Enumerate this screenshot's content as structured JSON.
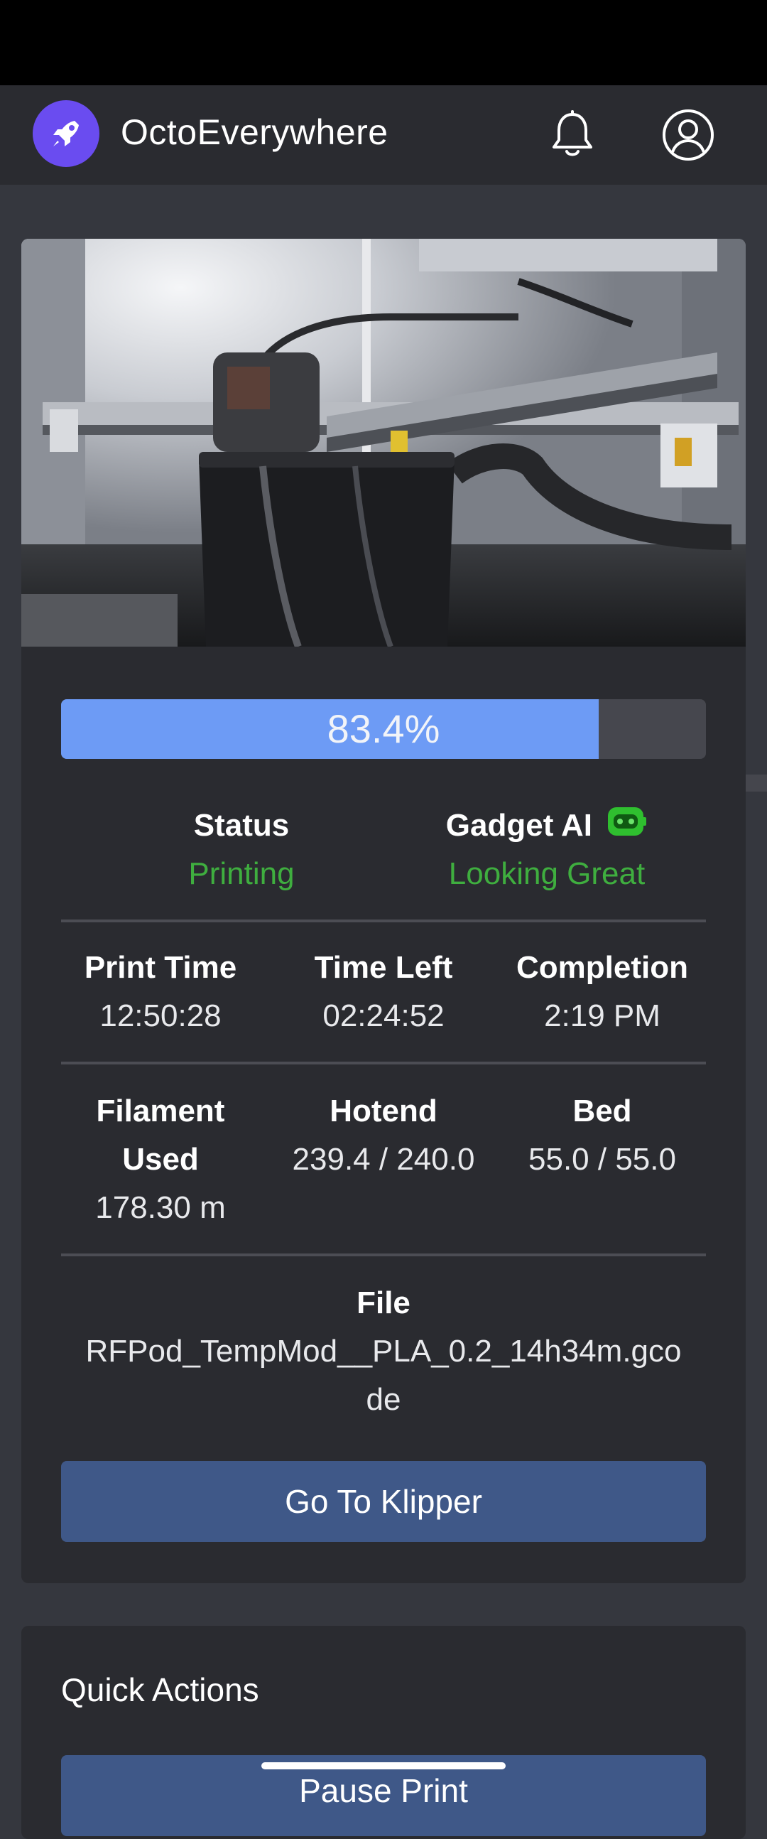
{
  "app": {
    "title": "OctoEverywhere"
  },
  "header": {
    "notifications_icon": "bell-icon",
    "account_icon": "user-circle-icon"
  },
  "printer_card": {
    "webcam_alt": "Printer webcam",
    "progress": {
      "percent": 83.4,
      "label": "83.4%"
    },
    "status": {
      "label": "Status",
      "value": "Printing"
    },
    "gadget": {
      "label": "Gadget AI",
      "value": "Looking Great",
      "icon": "robot-face-icon"
    },
    "print_time": {
      "label": "Print Time",
      "value": "12:50:28"
    },
    "time_left": {
      "label": "Time Left",
      "value": "02:24:52"
    },
    "completion": {
      "label": "Completion",
      "value": "2:19 PM"
    },
    "filament": {
      "label_line1": "Filament",
      "label_line2": "Used",
      "value": "178.30 m"
    },
    "hotend": {
      "label": "Hotend",
      "value": "239.4 / 240.0"
    },
    "bed": {
      "label": "Bed",
      "value": "55.0 / 55.0"
    },
    "file": {
      "label": "File",
      "name_line1": "RFPod_TempMod__PLA_0.2_14h34m.gco",
      "name_line2": "de"
    },
    "klipper_button": "Go To Klipper"
  },
  "quick_actions": {
    "title": "Quick Actions",
    "pause_button": "Pause Print"
  },
  "colors": {
    "background": "#35373e",
    "card": "#2a2b30",
    "progress_fill": "#6d9bf5",
    "status_green": "#3fae3f",
    "button_blue": "#3f5888",
    "logo_purple": "#6a4cf0"
  }
}
